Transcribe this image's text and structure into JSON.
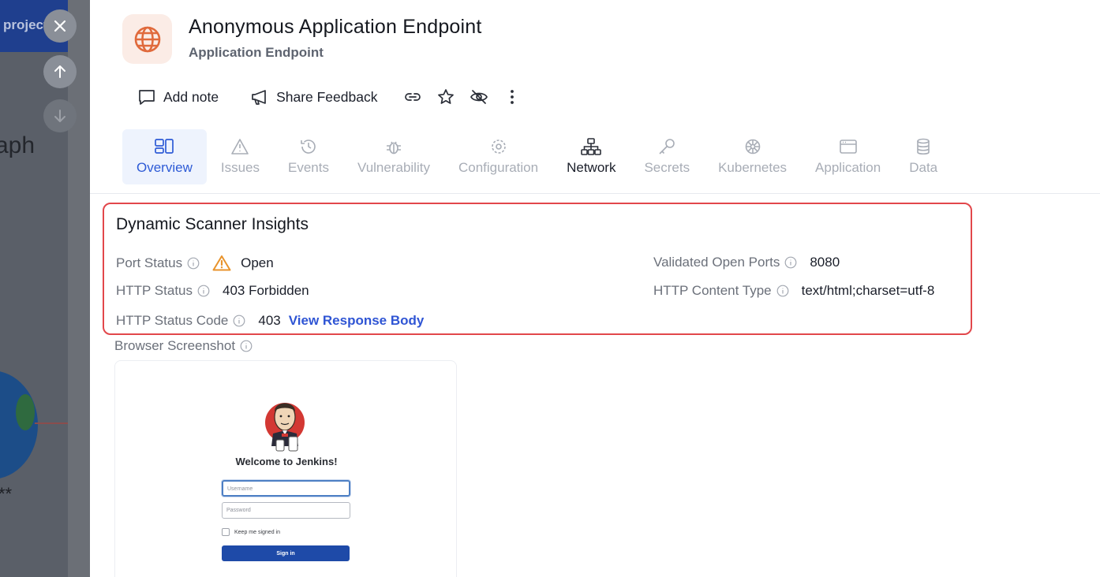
{
  "background": {
    "topbar_text": "projects",
    "heading_fragment": "aph",
    "stars_fragment": "**"
  },
  "header": {
    "title": "Anonymous Application Endpoint",
    "subtitle": "Application Endpoint",
    "icon": "globe-icon",
    "icon_color": "#e06a3c"
  },
  "actions": {
    "add_note": "Add note",
    "share_feedback": "Share Feedback"
  },
  "tabs": [
    {
      "label": "Overview",
      "icon": "overview-icon"
    },
    {
      "label": "Issues",
      "icon": "warning-icon"
    },
    {
      "label": "Events",
      "icon": "history-icon"
    },
    {
      "label": "Vulnerability",
      "icon": "bug-icon"
    },
    {
      "label": "Configuration",
      "icon": "gear-icon"
    },
    {
      "label": "Network",
      "icon": "network-icon"
    },
    {
      "label": "Secrets",
      "icon": "key-icon"
    },
    {
      "label": "Kubernetes",
      "icon": "helm-icon"
    },
    {
      "label": "Application",
      "icon": "window-icon"
    },
    {
      "label": "Data",
      "icon": "database-icon"
    }
  ],
  "insights": {
    "title": "Dynamic Scanner Insights",
    "port_status_label": "Port Status",
    "port_status_value": "Open",
    "http_status_label": "HTTP Status",
    "http_status_value": "403 Forbidden",
    "http_status_code_label": "HTTP Status Code",
    "http_status_code_value": "403",
    "view_response_body": "View Response Body",
    "validated_open_ports_label": "Validated Open Ports",
    "validated_open_ports_value": "8080",
    "http_content_type_label": "HTTP Content Type",
    "http_content_type_value": "text/html;charset=utf-8",
    "warning_color": "#e8932c",
    "link_color": "#2f55d4",
    "highlight_border_color": "#e2474b"
  },
  "screenshot": {
    "label": "Browser Screenshot",
    "welcome": "Welcome to Jenkins!",
    "username_placeholder": "Username",
    "password_placeholder": "Password",
    "keep_signed_in": "Keep me signed in",
    "sign_in": "Sign in"
  }
}
